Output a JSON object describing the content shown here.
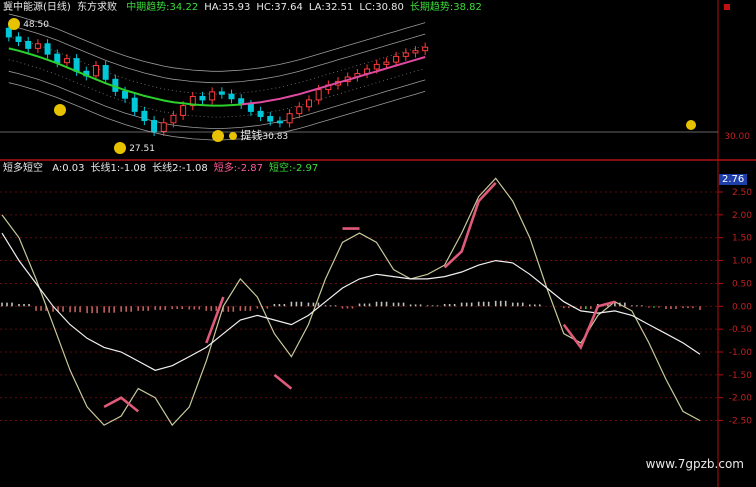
{
  "colors": {
    "bg": "#000000",
    "axis": "#b01010",
    "grid_dot": "#7a1010",
    "band": "#9a9a9a",
    "mid_line": "#e04aa0",
    "mid_line_early": "#2bd02b",
    "candle_up": "#ff3b3b",
    "candle_down": "#00c8d8",
    "line_white": "#f0f0f0",
    "line_khaki": "#c8c89a",
    "line_pink": "#e05a7a",
    "hist_pos": "#c0c0c0",
    "hist_neg": "#c06060",
    "hist_green": "#2bd02b",
    "text_white": "#e8e8e8",
    "text_green": "#3cdc3c",
    "text_pink": "#ff5a9a",
    "text_yellow": "#e0e000"
  },
  "upper_header": {
    "title": "冀中能源(日线)",
    "subtitle": "东方求败",
    "items": [
      {
        "text": "中期趋势:34.22",
        "color": "#3cdc3c"
      },
      {
        "text": "HA:35.93",
        "color": "#e8e8e8"
      },
      {
        "text": "HC:37.64",
        "color": "#e8e8e8"
      },
      {
        "text": "LA:32.51",
        "color": "#e8e8e8"
      },
      {
        "text": "LC:30.80",
        "color": "#e8e8e8"
      },
      {
        "text": "长期趋势:38.82",
        "color": "#3cdc3c"
      }
    ]
  },
  "lower_header": {
    "title": "短多短空",
    "items": [
      {
        "text": "A:0.03",
        "color": "#e8e8e8"
      },
      {
        "text": "长线1:-1.08",
        "color": "#e8e8e8"
      },
      {
        "text": "长线2:-1.08",
        "color": "#e8e8e8"
      },
      {
        "text": "短多:-2.87",
        "color": "#ff5a9a"
      },
      {
        "text": "短空:-2.97",
        "color": "#3cdc3c"
      }
    ]
  },
  "annotations": {
    "high": "48.50",
    "low": "27.51",
    "signal": "提钱",
    "signal_value": "30.83"
  },
  "price_axis_label": "30.00",
  "current_value_tag": "2.76",
  "watermark": "www.7gpzb.com",
  "chart_data": [
    {
      "type": "candlestick",
      "name": "price",
      "mid_trend": [
        44.0,
        43.6,
        43.1,
        42.6,
        42.0,
        41.4,
        40.7,
        40.0,
        39.3,
        38.6,
        37.9,
        37.3,
        36.7,
        36.2,
        35.7,
        35.3,
        34.9,
        34.6,
        34.4,
        34.2,
        34.1,
        34.0,
        34.0,
        34.1,
        34.2,
        34.4,
        34.6,
        34.9,
        35.2,
        35.6,
        36.0,
        36.5,
        37.0,
        37.5,
        38.0,
        38.5,
        39.0,
        39.5,
        40.0,
        40.5,
        41.0,
        41.5,
        42.0,
        42.5
      ],
      "open": [
        47.5,
        46.0,
        45.2,
        44.0,
        44.8,
        43.0,
        41.5,
        42.2,
        40.0,
        39.2,
        41.0,
        38.6,
        36.5,
        35.3,
        33.0,
        31.4,
        29.5,
        31.0,
        32.3,
        34.0,
        35.6,
        35.0,
        36.4,
        36.0,
        35.2,
        34.2,
        33.0,
        32.1,
        31.3,
        31.0,
        32.6,
        33.8,
        35.0,
        36.8,
        37.6,
        38.2,
        39.0,
        39.6,
        40.4,
        41.2,
        41.6,
        42.6,
        43.2,
        43.6
      ],
      "close": [
        46.0,
        45.2,
        44.0,
        44.8,
        43.0,
        41.5,
        42.2,
        40.0,
        39.2,
        41.0,
        38.6,
        36.5,
        35.3,
        33.0,
        31.4,
        29.5,
        31.0,
        32.3,
        34.0,
        35.6,
        35.0,
        36.4,
        36.0,
        35.2,
        34.2,
        33.0,
        32.1,
        31.3,
        31.0,
        32.6,
        33.8,
        35.0,
        36.8,
        37.6,
        38.2,
        39.0,
        39.6,
        40.4,
        41.2,
        41.6,
        42.6,
        43.2,
        43.6,
        44.2
      ],
      "high": 48.5,
      "low": 27.51,
      "ylim": [
        28,
        50
      ]
    },
    {
      "type": "line",
      "name": "oscillator",
      "ylim": [
        -2.75,
        2.85
      ],
      "yticks": [
        2.5,
        2.0,
        1.5,
        1.0,
        0.5,
        0.0,
        -0.5,
        -1.0,
        -1.5,
        -2.0,
        -2.5
      ],
      "series": [
        {
          "color": "#c8c89a",
          "values": [
            2.0,
            1.5,
            0.6,
            -0.4,
            -1.4,
            -2.2,
            -2.6,
            -2.4,
            -1.8,
            -2.0,
            -2.6,
            -2.2,
            -1.2,
            0.0,
            0.6,
            0.2,
            -0.6,
            -1.1,
            -0.4,
            0.6,
            1.4,
            1.6,
            1.4,
            0.8,
            0.6,
            0.7,
            0.9,
            1.6,
            2.4,
            2.8,
            2.3,
            1.5,
            0.4,
            -0.6,
            -0.8,
            -0.2,
            0.1,
            -0.1,
            -0.8,
            -1.6,
            -2.3,
            -2.5
          ]
        },
        {
          "color": "#f0f0f0",
          "values": [
            1.6,
            1.0,
            0.5,
            0.0,
            -0.4,
            -0.7,
            -0.9,
            -1.0,
            -1.2,
            -1.4,
            -1.3,
            -1.1,
            -0.9,
            -0.6,
            -0.3,
            -0.2,
            -0.3,
            -0.4,
            -0.2,
            0.1,
            0.4,
            0.6,
            0.7,
            0.65,
            0.6,
            0.6,
            0.65,
            0.75,
            0.9,
            1.0,
            0.95,
            0.7,
            0.4,
            0.1,
            -0.1,
            -0.15,
            -0.1,
            -0.2,
            -0.4,
            -0.6,
            -0.8,
            -1.05
          ]
        },
        {
          "color": "#e05a7a",
          "values": [
            null,
            null,
            null,
            null,
            null,
            null,
            -2.2,
            -2.0,
            -2.3,
            null,
            null,
            null,
            -0.8,
            0.2,
            null,
            null,
            -1.5,
            -1.8,
            null,
            null,
            1.7,
            1.7,
            null,
            null,
            null,
            null,
            0.85,
            1.2,
            2.3,
            2.7,
            null,
            null,
            null,
            -0.4,
            -0.9,
            0.0,
            0.1,
            null,
            null,
            null,
            null,
            null
          ]
        }
      ],
      "histogram": [
        0.08,
        0.05,
        -0.1,
        -0.12,
        -0.13,
        -0.15,
        -0.14,
        -0.12,
        -0.1,
        -0.08,
        -0.06,
        -0.07,
        -0.1,
        -0.12,
        -0.1,
        -0.05,
        0.05,
        0.1,
        0.08,
        0.02,
        -0.05,
        0.06,
        0.1,
        0.08,
        0.04,
        0.02,
        0.05,
        0.08,
        0.1,
        0.12,
        0.08,
        0.04,
        0.0,
        -0.04,
        -0.06,
        0.05,
        0.08,
        0.02,
        -0.03,
        -0.06,
        -0.04,
        -0.08
      ]
    }
  ]
}
